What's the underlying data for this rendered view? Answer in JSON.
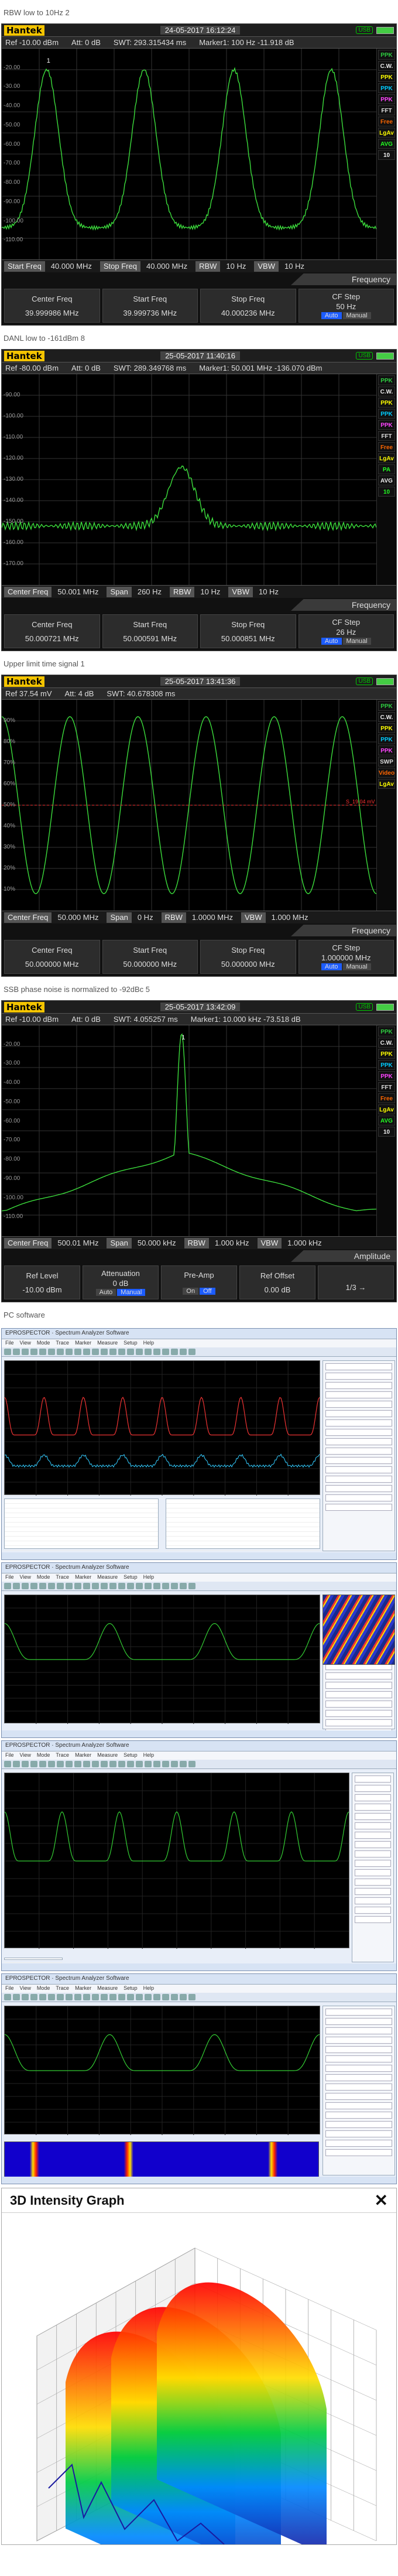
{
  "sections": [
    {
      "caption": "RBW low to 10Hz 2",
      "date": "24-05-2017 16:12:24",
      "ref": "Ref -10.00 dBm",
      "att": "Att: 0 dB",
      "swt": "SWT: 293.315434 ms",
      "marker": "Marker1: 100 Hz  -11.918 dB",
      "ylabels": [
        "-20.00",
        "-30.00",
        "-40.00",
        "-50.00",
        "-60.00",
        "-70.00",
        "-80.00",
        "-90.00",
        "-100.00",
        "-110.00"
      ],
      "side": [
        "PPK",
        "C.W.",
        "PPK",
        "PPK",
        "PPK",
        "FFT",
        "Free",
        "LgAv",
        "AVG",
        "10"
      ],
      "bottom": [
        [
          "Start Freq",
          "40.000 MHz"
        ],
        [
          "Stop Freq",
          "40.000 MHz"
        ],
        [
          "RBW",
          "10 Hz"
        ],
        [
          "VBW",
          "10 Hz"
        ]
      ],
      "mode": "Frequency",
      "softkeys": [
        {
          "label": "Center Freq",
          "value": "39.999986 MHz"
        },
        {
          "label": "Start Freq",
          "value": "39.999736 MHz"
        },
        {
          "label": "Stop Freq",
          "value": "40.000236 MHz"
        },
        {
          "label": "CF Step",
          "value": "50 Hz",
          "toggle": [
            "Auto",
            "Manual"
          ],
          "on": 0
        }
      ]
    },
    {
      "caption": "DANL low to -161dBm 8",
      "date": "25-05-2017 11:40:16",
      "ref": "Ref -80.00 dBm",
      "att": "Att: 0 dB",
      "swt": "SWT: 289.349768 ms",
      "marker": "Marker1: 50.001 MHz  -136.070 dBm",
      "ylabels": [
        "-90.00",
        "-100.00",
        "-110.00",
        "-120.00",
        "-130.00",
        "-140.00",
        "-150.00",
        "-160.00",
        "-170.00"
      ],
      "side": [
        "PPK",
        "C.W.",
        "PPK",
        "PPK",
        "PPK",
        "FFT",
        "Free",
        "LgAv",
        "PA",
        "AVG",
        "10"
      ],
      "bottom": [
        [
          "Center Freq",
          "50.001 MHz"
        ],
        [
          "Span",
          "260 Hz"
        ],
        [
          "RBW",
          "10 Hz"
        ],
        [
          "VBW",
          "10 Hz"
        ]
      ],
      "mode": "Frequency",
      "softkeys": [
        {
          "label": "Center Freq",
          "value": "50.000721 MHz"
        },
        {
          "label": "Start Freq",
          "value": "50.000591 MHz"
        },
        {
          "label": "Stop Freq",
          "value": "50.000851 MHz"
        },
        {
          "label": "CF Step",
          "value": "26 Hz",
          "toggle": [
            "Auto",
            "Manual"
          ],
          "on": 0
        }
      ]
    },
    {
      "caption": "Upper limit time signal 1",
      "date": "25-05-2017 13:41:36",
      "ref": "Ref 37.54 mV",
      "att": "Att: 4 dB",
      "swt": "SWT: 40.678308 ms",
      "marker": "",
      "ylabels": [
        "90%",
        "80%",
        "70%",
        "60%",
        "50%",
        "40%",
        "30%",
        "20%",
        "10%"
      ],
      "side": [
        "PPK",
        "C.W.",
        "PPK",
        "PPK",
        "PPK",
        "SWP",
        "Video",
        "LgAv"
      ],
      "bottom": [
        [
          "Center Freq",
          "50.000 MHz"
        ],
        [
          "Span",
          "0 Hz"
        ],
        [
          "RBW",
          "1.0000 MHz"
        ],
        [
          "VBW",
          "1.000 MHz"
        ]
      ],
      "mode": "Frequency",
      "level_note": "S_19.04 mV",
      "softkeys": [
        {
          "label": "Center Freq",
          "value": "50.000000 MHz"
        },
        {
          "label": "Start Freq",
          "value": "50.000000 MHz"
        },
        {
          "label": "Stop Freq",
          "value": "50.000000 MHz"
        },
        {
          "label": "CF Step",
          "value": "1.000000 MHz",
          "toggle": [
            "Auto",
            "Manual"
          ],
          "on": 0
        }
      ]
    },
    {
      "caption": "SSB phase noise is normalized to -92dBc 5",
      "date": "25-05-2017 13:42:09",
      "ref": "Ref -10.00 dBm",
      "att": "Att: 0 dB",
      "swt": "SWT: 4.055257 ms",
      "marker": "Marker1: 10.000 kHz  -73.518 dB",
      "ylabels": [
        "-20.00",
        "-30.00",
        "-40.00",
        "-50.00",
        "-60.00",
        "-70.00",
        "-80.00",
        "-90.00",
        "-100.00",
        "-110.00"
      ],
      "side": [
        "PPK",
        "C.W.",
        "PPK",
        "PPK",
        "PPK",
        "FFT",
        "Free",
        "LgAv",
        "AVG",
        "10"
      ],
      "bottom": [
        [
          "Center Freq",
          "500.01 MHz"
        ],
        [
          "Span",
          "50.000 kHz"
        ],
        [
          "RBW",
          "1.000 kHz"
        ],
        [
          "VBW",
          "1.000 kHz"
        ]
      ],
      "mode": "Amplitude",
      "softkeys": [
        {
          "label": "Ref Level",
          "value": "-10.00 dBm"
        },
        {
          "label": "Attenuation",
          "value": "0 dB",
          "toggle": [
            "Auto",
            "Manual"
          ],
          "on": 1
        },
        {
          "label": "Pre-Amp",
          "value": "",
          "toggle": [
            "On",
            "Off"
          ],
          "on": 1
        },
        {
          "label": "Ref Offset",
          "value": "0.00 dB"
        },
        {
          "label": "",
          "value": "1/3 →"
        }
      ]
    }
  ],
  "pc_caption": "PC software",
  "pc_title": "EPROSPECTOR · Spectrum Analyzer Software",
  "pc_menu": [
    "File",
    "View",
    "Mode",
    "Trace",
    "Marker",
    "Measure",
    "Setup",
    "Help"
  ],
  "intensity_title": "3D Intensity Graph",
  "intensity_close": "✕"
}
